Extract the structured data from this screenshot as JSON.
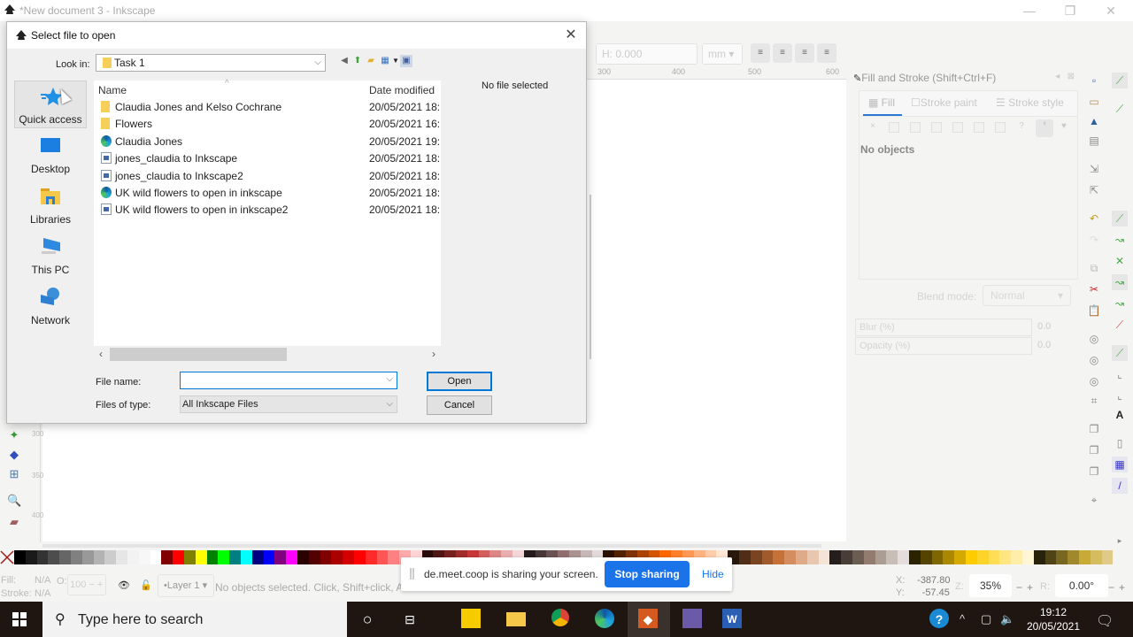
{
  "app": {
    "window_title": "*New document 3 - Inkscape",
    "toolbar": {
      "h_label": "H:",
      "h_value": "0.000",
      "unit": "mm"
    },
    "ruler_ticks": [
      "300",
      "400",
      "500",
      "600"
    ],
    "vruler_ticks": [
      "300",
      "350",
      "400"
    ]
  },
  "dialog": {
    "title": "Select file to open",
    "look_in_label": "Look in:",
    "look_in_value": "Task 1",
    "places": [
      {
        "label": "Quick access",
        "icon": "quick-access-star-icon"
      },
      {
        "label": "Desktop",
        "icon": "desktop-icon"
      },
      {
        "label": "Libraries",
        "icon": "libraries-icon"
      },
      {
        "label": "This PC",
        "icon": "this-pc-icon"
      },
      {
        "label": "Network",
        "icon": "network-icon"
      }
    ],
    "columns": {
      "name": "Name",
      "date": "Date modified"
    },
    "files": [
      {
        "name": "Claudia Jones and Kelso Cochrane",
        "date": "20/05/2021 18:",
        "type": "folder"
      },
      {
        "name": "Flowers",
        "date": "20/05/2021 16:",
        "type": "folder"
      },
      {
        "name": "Claudia Jones",
        "date": "20/05/2021 19:",
        "type": "edge"
      },
      {
        "name": "jones_claudia to Inkscape",
        "date": "20/05/2021 18:",
        "type": "image"
      },
      {
        "name": "jones_claudia to Inkscape2",
        "date": "20/05/2021 18:",
        "type": "image"
      },
      {
        "name": "UK wild flowers to open in inkscape",
        "date": "20/05/2021 18:",
        "type": "edge"
      },
      {
        "name": "UK wild flowers to open in inkscape2",
        "date": "20/05/2021 18:",
        "type": "image"
      }
    ],
    "preview_text": "No file selected",
    "file_name_label": "File name:",
    "file_name_value": "",
    "files_of_type_label": "Files of type:",
    "files_of_type_value": "All Inkscape Files",
    "open_label": "Open",
    "cancel_label": "Cancel"
  },
  "fill_stroke": {
    "title": "Fill and Stroke (Shift+Ctrl+F)",
    "tabs": [
      "Fill",
      "Stroke paint",
      "Stroke style"
    ],
    "no_objects": "No objects",
    "blend_label": "Blend mode:",
    "blend_value": "Normal",
    "blur_label": "Blur (%)",
    "blur_value": "0.0",
    "opacity_label": "Opacity (%)",
    "opacity_value": "0.0"
  },
  "status": {
    "fill_label": "Fill:",
    "fill_value": "N/A",
    "stroke_label": "Stroke:",
    "stroke_value": "N/A",
    "o_label": "O:",
    "o_value": "100",
    "layer": "Layer 1",
    "message": "No objects selected. Click, Shift+click, A",
    "x_label": "X:",
    "x_value": "-387.80",
    "y_label": "Y:",
    "y_value": "-57.45",
    "z_label": "Z:",
    "zoom": "35%",
    "r_label": "R:",
    "rotation": "0.00°"
  },
  "share_banner": {
    "text": "de.meet.coop is sharing your screen.",
    "stop_label": "Stop sharing",
    "hide_label": "Hide",
    "accent": "#1a73e8"
  },
  "taskbar": {
    "search_placeholder": "Type here to search",
    "time": "19:12",
    "date": "20/05/2021"
  },
  "palette": [
    "#000000",
    "#1a1a1a",
    "#333333",
    "#4d4d4d",
    "#666666",
    "#808080",
    "#999999",
    "#b3b3b3",
    "#cccccc",
    "#e6e6e6",
    "#f2f2f2",
    "#f7f7f7",
    "#ffffff",
    "#800000",
    "#ff0000",
    "#808000",
    "#ffff00",
    "#008000",
    "#00ff00",
    "#008080",
    "#00ffff",
    "#000080",
    "#0000ff",
    "#800080",
    "#ff00ff",
    "#2b0000",
    "#550000",
    "#800000",
    "#aa0000",
    "#d40000",
    "#ff0000",
    "#ff2a2a",
    "#ff5555",
    "#ff8080",
    "#ffaaaa",
    "#ffd5d5",
    "#280b0b",
    "#501616",
    "#782121",
    "#a02c2c",
    "#c83737",
    "#d35f5f",
    "#de8787",
    "#e9afaf",
    "#f4d7d7",
    "#241c1c",
    "#483737",
    "#6c5353",
    "#916f6f",
    "#ac9393",
    "#c8b7b7",
    "#e3dbdb",
    "#2b1100",
    "#552200",
    "#803300",
    "#aa4400",
    "#d45500",
    "#ff6600",
    "#ff7f2a",
    "#ff9955",
    "#ffb380",
    "#ffccaa",
    "#ffe6d5",
    "#28170b",
    "#502d16",
    "#784421",
    "#a05a2c",
    "#c87137",
    "#d38d5f",
    "#deaa87",
    "#e9c6af",
    "#f4e3d7",
    "#241f1c",
    "#483e37",
    "#6c5d53",
    "#917c6f",
    "#ac9d93",
    "#c8beb7",
    "#e3dedb",
    "#2b2200",
    "#554400",
    "#806600",
    "#aa8800",
    "#d4aa00",
    "#ffcc00",
    "#ffd42a",
    "#ffdd55",
    "#ffe680",
    "#ffeeaa",
    "#fff6d5",
    "#28220b",
    "#504416",
    "#786721",
    "#a0892c",
    "#c8ab37",
    "#d4bc5f",
    "#dfcb87"
  ]
}
